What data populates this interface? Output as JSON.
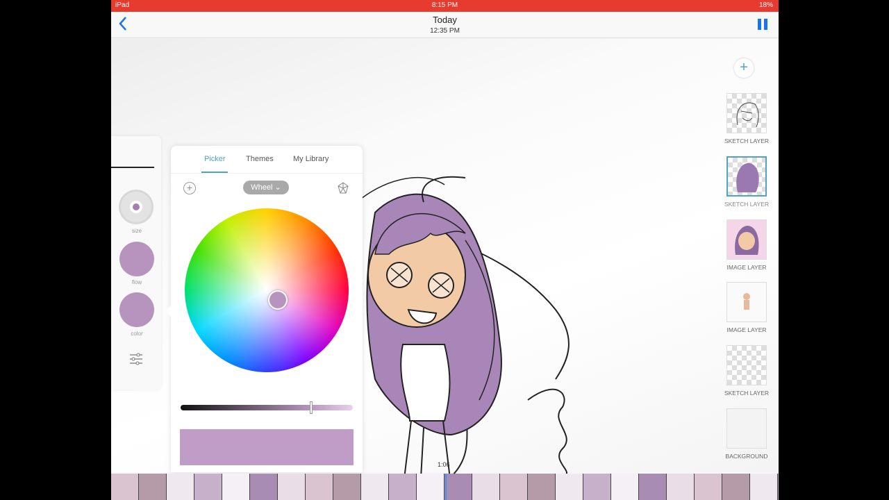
{
  "status_bar": {
    "device": "iPad",
    "time": "8:15 PM",
    "battery": "18%"
  },
  "nav": {
    "back_icon": "chevron-left-icon",
    "title": "Today",
    "subtitle": "12:35 PM",
    "pause_icon": "pause-icon"
  },
  "toolbar": {
    "size_label": "size",
    "flow_label": "flow",
    "color_label": "color",
    "current_color": "#b794bd"
  },
  "color_panel": {
    "tabs": [
      {
        "label": "Picker",
        "active": true
      },
      {
        "label": "Themes",
        "active": false
      },
      {
        "label": "My Library",
        "active": false
      }
    ],
    "mode": "Wheel ⌄",
    "swatch_color": "#bf9dc6"
  },
  "layers": {
    "items": [
      {
        "name": "SKETCH LAYER",
        "selected": false
      },
      {
        "name": "SKETCH LAYER",
        "selected": true
      },
      {
        "name": "IMAGE LAYER",
        "selected": false
      },
      {
        "name": "IMAGE LAYER",
        "selected": false
      },
      {
        "name": "SKETCH LAYER",
        "selected": false
      },
      {
        "name": "BACKGROUND",
        "selected": false
      }
    ]
  },
  "timeline": {
    "position_label": "1:06"
  },
  "colors": {
    "accent": "#4fa4c3",
    "status_bar": "#e63b2e",
    "hair": "#a886b8",
    "skin": "#f3caa6"
  }
}
